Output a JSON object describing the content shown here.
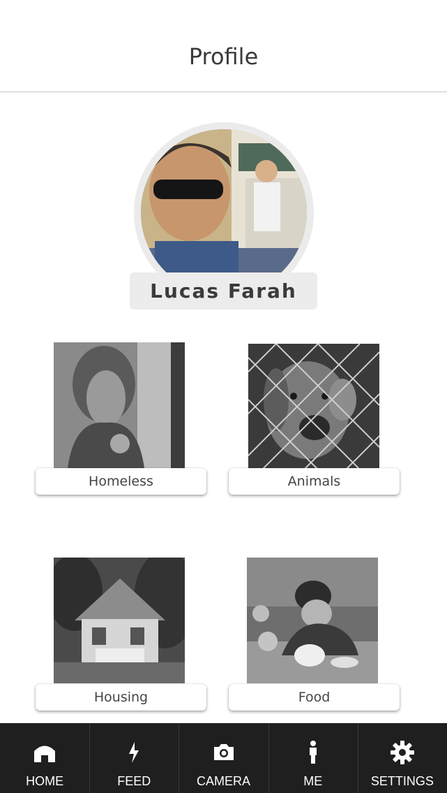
{
  "header": {
    "title": "Profile"
  },
  "profile": {
    "name": "Lucas Farah"
  },
  "causes": [
    {
      "label": "Homeless"
    },
    {
      "label": "Animals"
    },
    {
      "label": "Housing"
    },
    {
      "label": "Food"
    }
  ],
  "tabbar": {
    "items": [
      {
        "label": "HOME",
        "icon": "home-icon"
      },
      {
        "label": "FEED",
        "icon": "feed-icon"
      },
      {
        "label": "CAMERA",
        "icon": "camera-icon"
      },
      {
        "label": "ME",
        "icon": "person-icon"
      },
      {
        "label": "SETTINGS",
        "icon": "gear-icon"
      }
    ]
  },
  "colors": {
    "tabbar_bg": "#1f1f1f",
    "badge_bg": "#ececec"
  }
}
